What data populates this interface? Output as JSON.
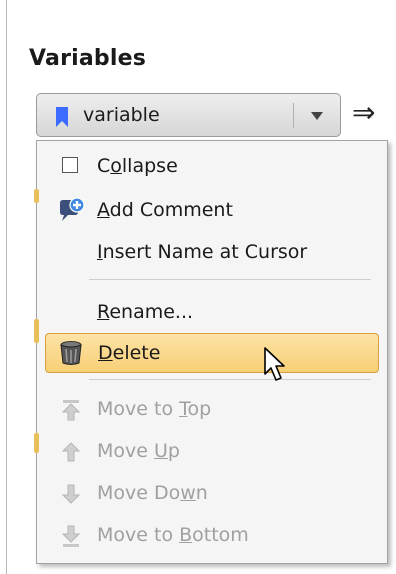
{
  "panel": {
    "title": "Variables"
  },
  "variable_select": {
    "value": "variable"
  },
  "arrow": "⇒",
  "menu": {
    "items": [
      {
        "pre": "C",
        "u": "o",
        "post": "llapse"
      },
      {
        "pre": "",
        "u": "A",
        "post": "dd Comment"
      },
      {
        "pre": "",
        "u": "I",
        "post": "nsert Name at Cursor"
      },
      {
        "pre": "",
        "u": "R",
        "post": "ename..."
      },
      {
        "pre": "",
        "u": "D",
        "post": "elete"
      },
      {
        "pre": "Move to ",
        "u": "T",
        "post": "op"
      },
      {
        "pre": "Move ",
        "u": "U",
        "post": "p"
      },
      {
        "pre": "Move Do",
        "u": "w",
        "post": "n"
      },
      {
        "pre": "Move to ",
        "u": "B",
        "post": "ottom"
      }
    ]
  },
  "colors": {
    "selected_bg": "#f8cf76",
    "selected_border": "#d9a03f",
    "bookmark": "#3b6bff",
    "disabled_text": "#a0a0a0"
  }
}
